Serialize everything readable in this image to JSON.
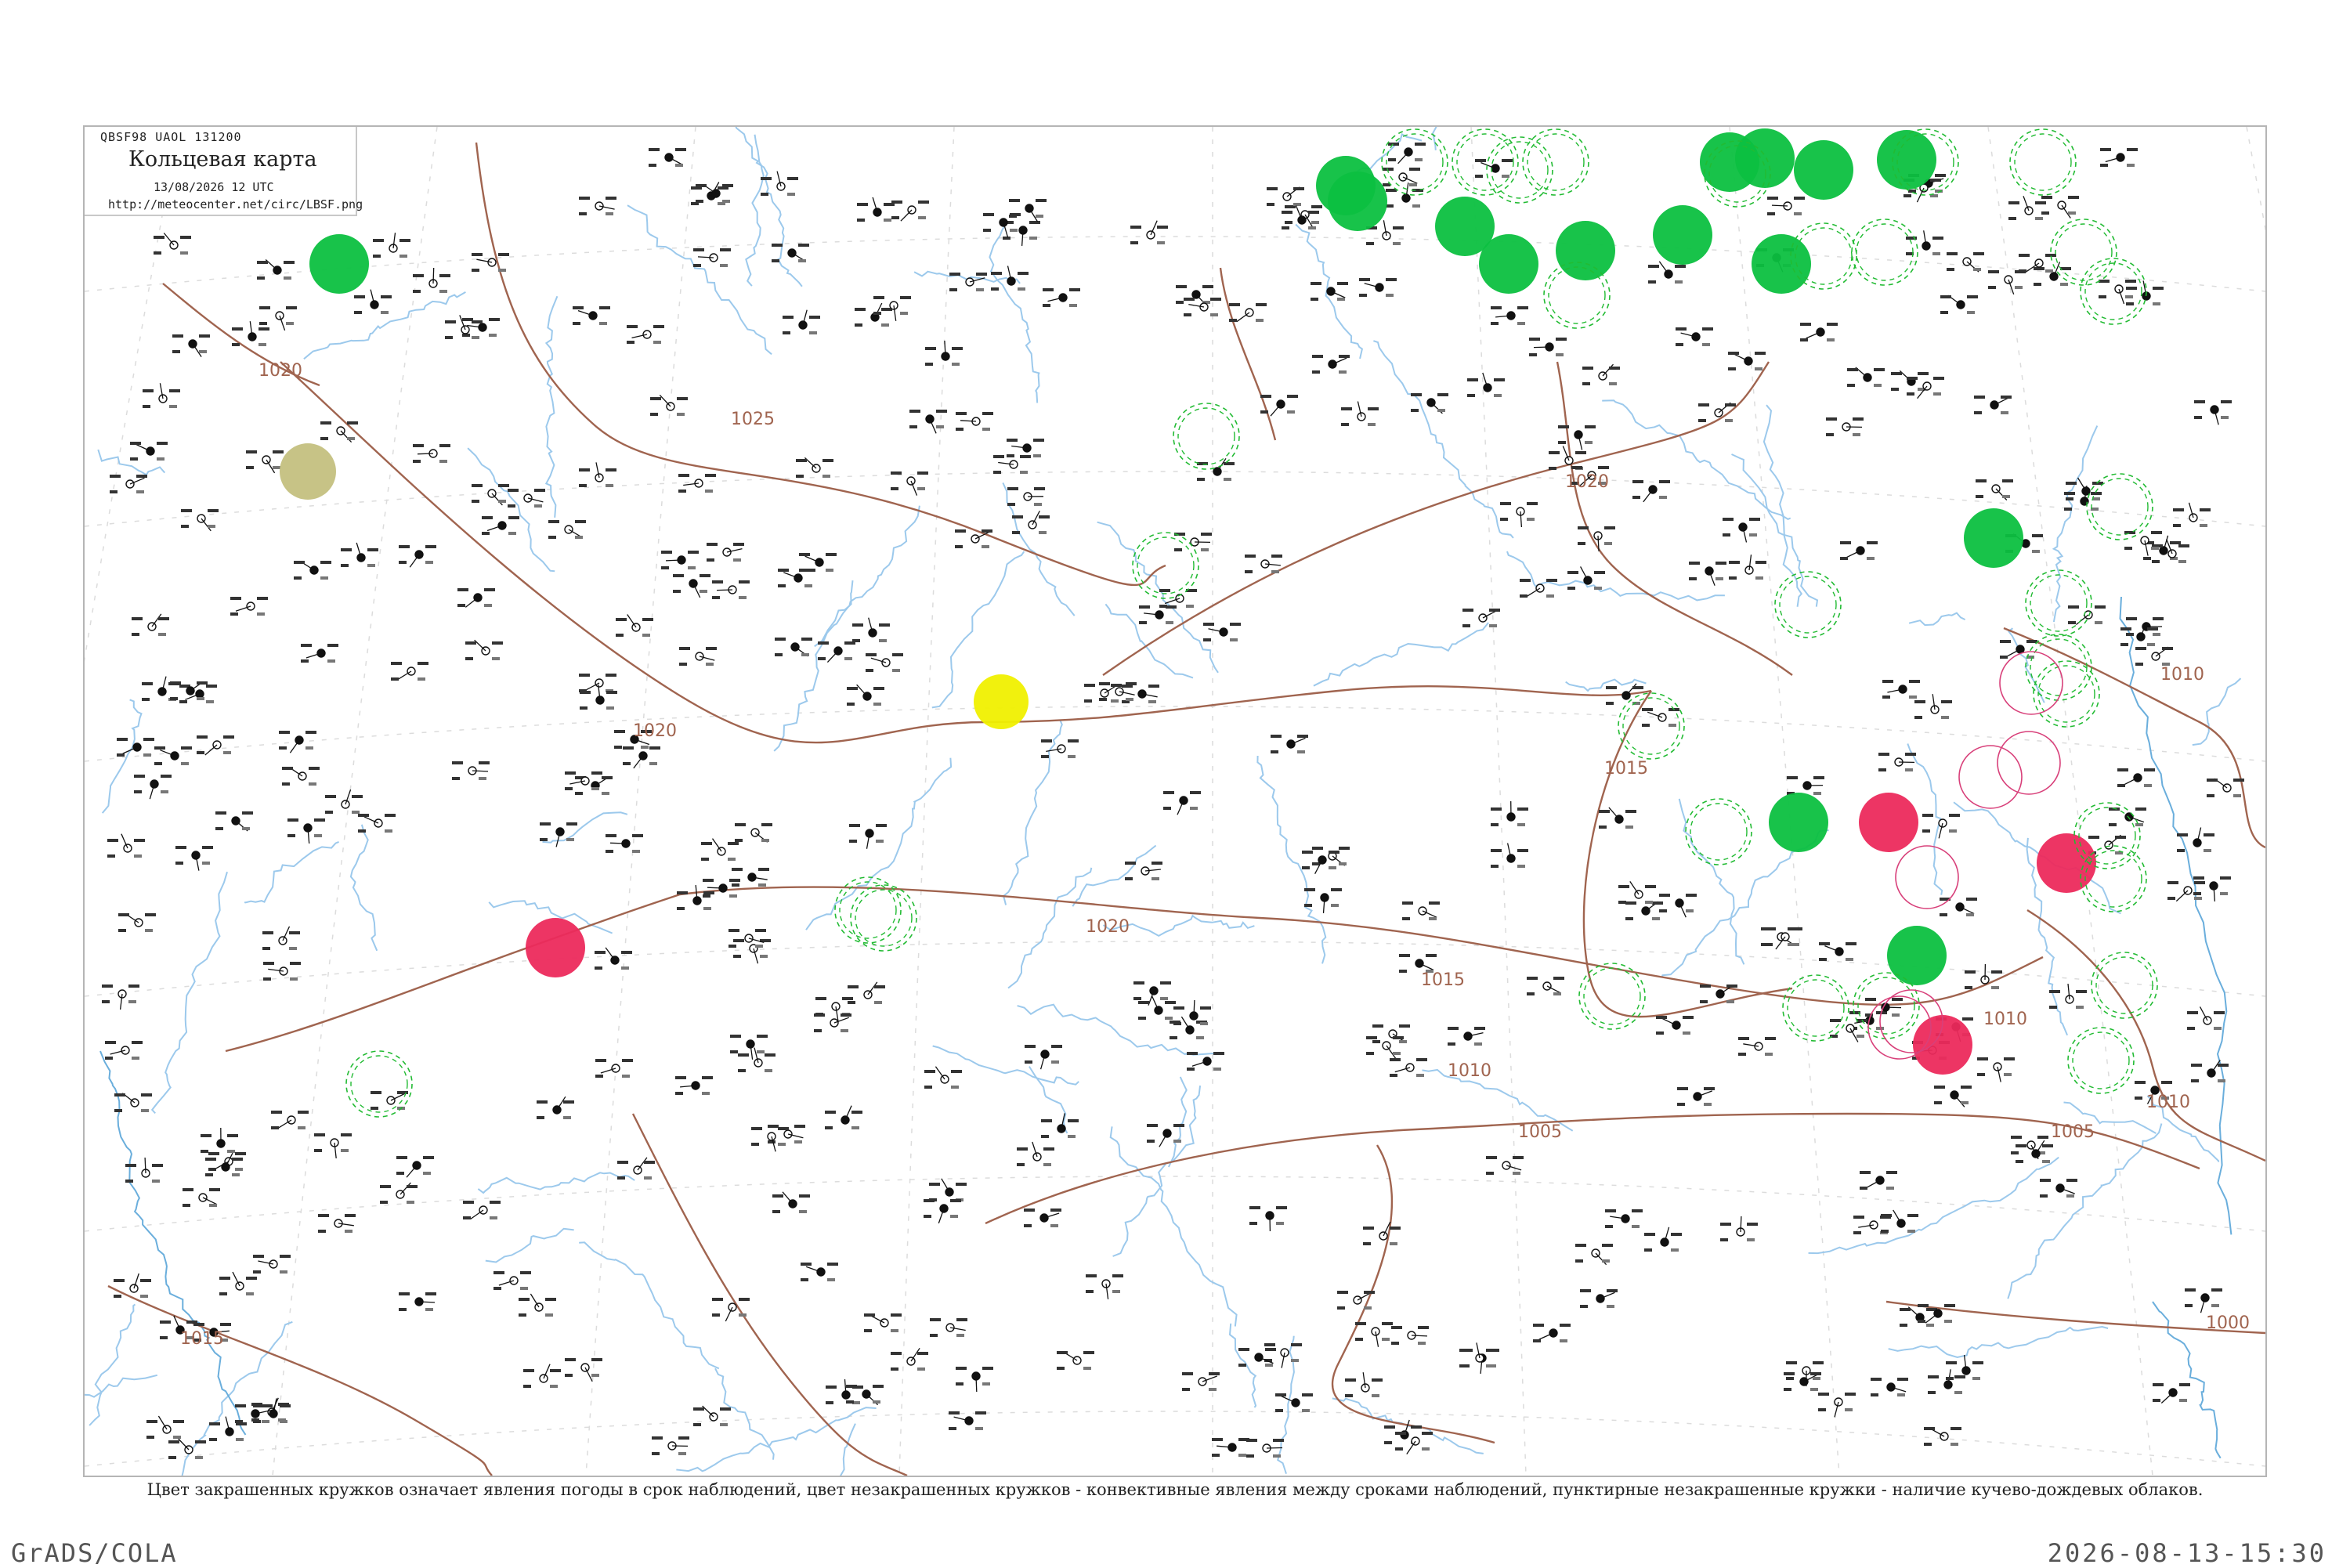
{
  "legend": {
    "code": "QBSF98  UAOL  131200",
    "title": "Кольцевая карта",
    "datetime": "13/08/2026 12 UTC",
    "url": "http://meteocenter.net/circ/LBSF.png"
  },
  "note": "Цвет закрашенных кружков означает явления погоды в срок наблюдений, цвет незакрашенных кружков - конвективные явления между сроками наблюдений, пунктирные незакрашенные кружки - наличие кучево-дождевых облаков.",
  "footer": {
    "software": "GrADS/COLA",
    "timestamp": "2026-08-13-15:30"
  },
  "isobars": [
    {
      "value": "1025",
      "label": "1025"
    },
    {
      "value": "1020",
      "label": "1020"
    },
    {
      "value": "1015",
      "label": "1015"
    },
    {
      "value": "1010",
      "label": "1010"
    },
    {
      "value": "1005",
      "label": "1005"
    },
    {
      "value": "1000",
      "label": "1000"
    }
  ],
  "colors": {
    "isobar": "#a0644f",
    "water": "#9cc9ec",
    "coast": "#6aaedc",
    "grid": "#dcdcdc",
    "thunder": "#0cc040",
    "rain": "#ec2a5c",
    "snow_fog": "#f0f000",
    "haze": "#c4c080",
    "cb_dashed": "#22bb33",
    "convective": "#d8407a"
  },
  "weather_markers": [
    {
      "type": "thunder",
      "label": "thunderstorm"
    },
    {
      "type": "rain",
      "label": "rain"
    },
    {
      "type": "fog",
      "label": "fog"
    },
    {
      "type": "haze",
      "label": "haze"
    }
  ]
}
